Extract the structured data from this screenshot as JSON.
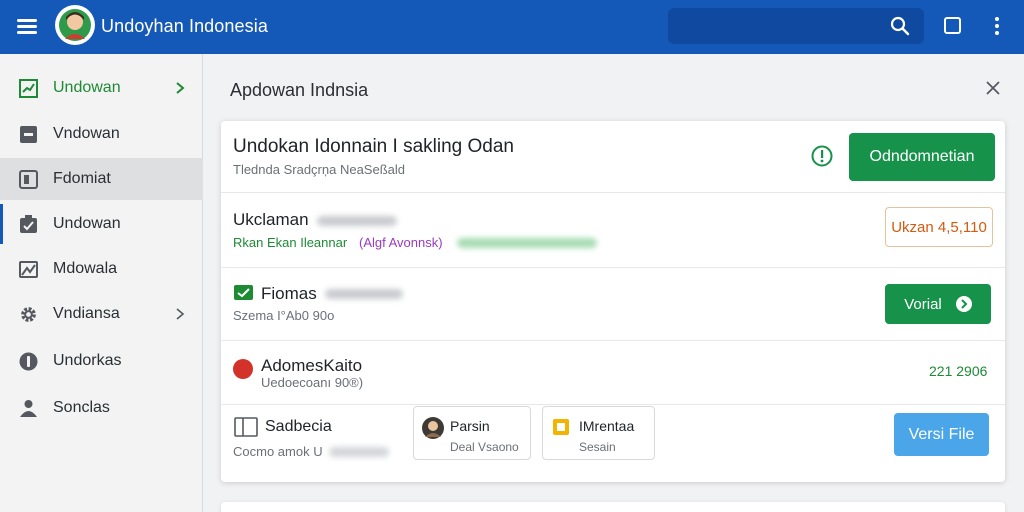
{
  "app": {
    "title": "Undoyhan Indonesia"
  },
  "sidebar": {
    "items": [
      {
        "label": "Undowan",
        "icon": "chart-icon",
        "active": true,
        "chevron": true
      },
      {
        "label": "Vndowan",
        "icon": "inbox-icon"
      },
      {
        "label": "Fdomiat",
        "icon": "document-icon",
        "selected": true
      },
      {
        "label": "Undowan",
        "icon": "clipboard-icon"
      },
      {
        "label": "Mdowala",
        "icon": "image-icon"
      },
      {
        "label": "Vndiansa",
        "icon": "gear-icon",
        "chevron": true
      },
      {
        "label": "Undorkas",
        "icon": "info-icon"
      },
      {
        "label": "Sonclas",
        "icon": "person-icon"
      }
    ]
  },
  "main": {
    "title": "Apdowan Indnsia",
    "header": {
      "title": "Undokan Idonnain I sakling Odan",
      "subtitle": "Tlednda Sradçrņa NeaSeßald",
      "button": "Odndomnetian"
    },
    "row2": {
      "title": "Ukclaman",
      "sub_part1": "Rkan Ekan Ileannar",
      "sub_part2": "(Algf Avonnsk)",
      "badge": "Ukzan 4,5,110"
    },
    "row3": {
      "title": "Fiomas",
      "subtitle": "Szema I°Ab0 90o",
      "button": "Vorial"
    },
    "row4": {
      "title": "AdomesKaito",
      "subtitle": "Uedoecoanı 90®)",
      "value": "221 2906"
    },
    "row5": {
      "title": "Sadbecia",
      "subtitle": "Cocmo amok U",
      "card1": {
        "title": "Parsin",
        "subtitle": "Deal Vsaono"
      },
      "card2": {
        "title": "IMrentaa",
        "subtitle": "Sesain"
      },
      "button": "Versi File"
    }
  },
  "colors": {
    "brand": "#1458b8",
    "accent_green": "#17924a",
    "accent_blue": "#4aa6e8",
    "warning_orange": "#d25b10",
    "alert_red": "#d3322b"
  }
}
